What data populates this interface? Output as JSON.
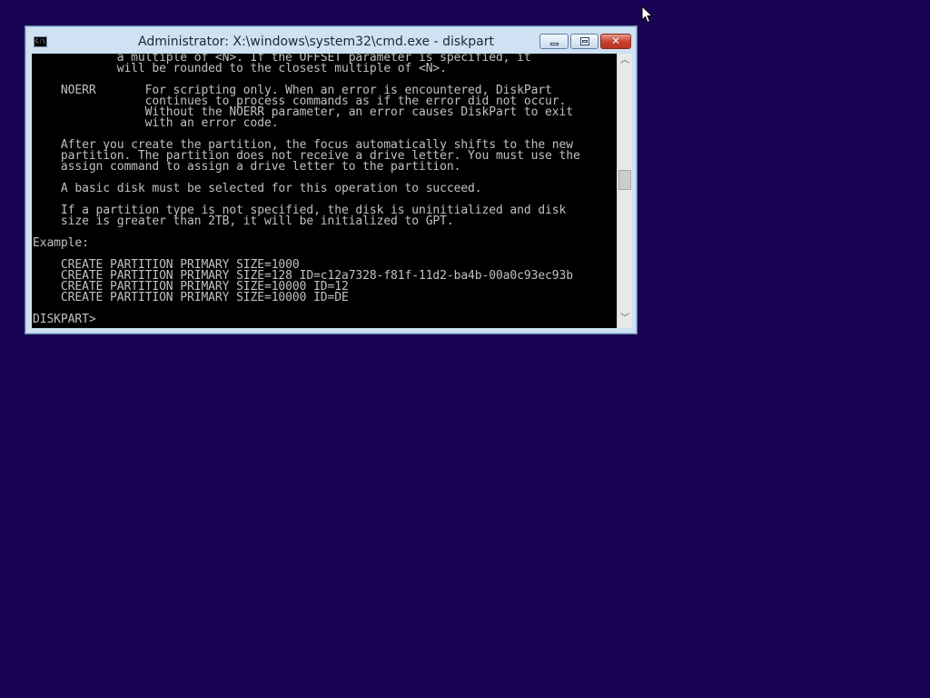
{
  "window": {
    "title": "Administrator: X:\\windows\\system32\\cmd.exe - diskpart",
    "icon_text": "C:\\",
    "controls": {
      "minimize": "minimize",
      "maximize": "maximize",
      "close": "✕"
    }
  },
  "console": {
    "lines": [
      "            a multiple of <N>. If the OFFSET parameter is specified, it",
      "            will be rounded to the closest multiple of <N>.",
      "",
      "    NOERR       For scripting only. When an error is encountered, DiskPart",
      "                continues to process commands as if the error did not occur.",
      "                Without the NOERR parameter, an error causes DiskPart to exit",
      "                with an error code.",
      "",
      "    After you create the partition, the focus automatically shifts to the new",
      "    partition. The partition does not receive a drive letter. You must use the",
      "    assign command to assign a drive letter to the partition.",
      "",
      "    A basic disk must be selected for this operation to succeed.",
      "",
      "    If a partition type is not specified, the disk is uninitialized and disk",
      "    size is greater than 2TB, it will be initialized to GPT.",
      "",
      "Example:",
      "",
      "    CREATE PARTITION PRIMARY SIZE=1000",
      "    CREATE PARTITION PRIMARY SIZE=128 ID=c12a7328-f81f-11d2-ba4b-00a0c93ec93b",
      "    CREATE PARTITION PRIMARY SIZE=10000 ID=12",
      "    CREATE PARTITION PRIMARY SIZE=10000 ID=DE",
      "",
      "DISKPART>"
    ]
  },
  "colors": {
    "desktop": "#1a0354",
    "console_bg": "#000000",
    "console_fg": "#c0c0c0"
  }
}
